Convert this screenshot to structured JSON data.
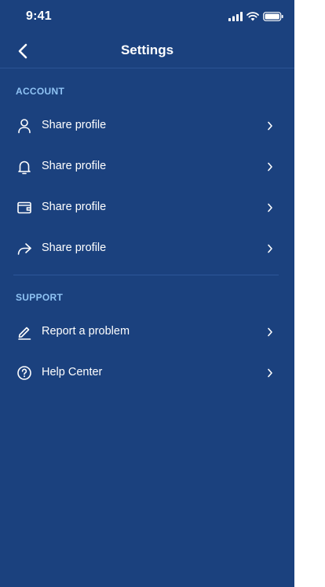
{
  "status_bar": {
    "time": "9:41",
    "icons": [
      "signal-icon",
      "wifi-icon",
      "battery-icon"
    ]
  },
  "nav": {
    "title": "Settings",
    "back_icon": "chevron-left-icon"
  },
  "sections": [
    {
      "header": "ACCOUNT",
      "items": [
        {
          "label": "Share profile",
          "icon": "user-icon"
        },
        {
          "label": "Share profile",
          "icon": "bell-icon"
        },
        {
          "label": "Share profile",
          "icon": "wallet-icon"
        },
        {
          "label": "Share profile",
          "icon": "share-arrow-icon"
        }
      ]
    },
    {
      "header": "SUPPORT",
      "items": [
        {
          "label": "Report a problem",
          "icon": "pencil-icon"
        },
        {
          "label": "Help Center",
          "icon": "help-circle-icon"
        }
      ]
    }
  ],
  "colors": {
    "background": "#1b417e",
    "section_header": "#8fc3f4",
    "divider": "#2d5799",
    "text": "#ffffff"
  }
}
